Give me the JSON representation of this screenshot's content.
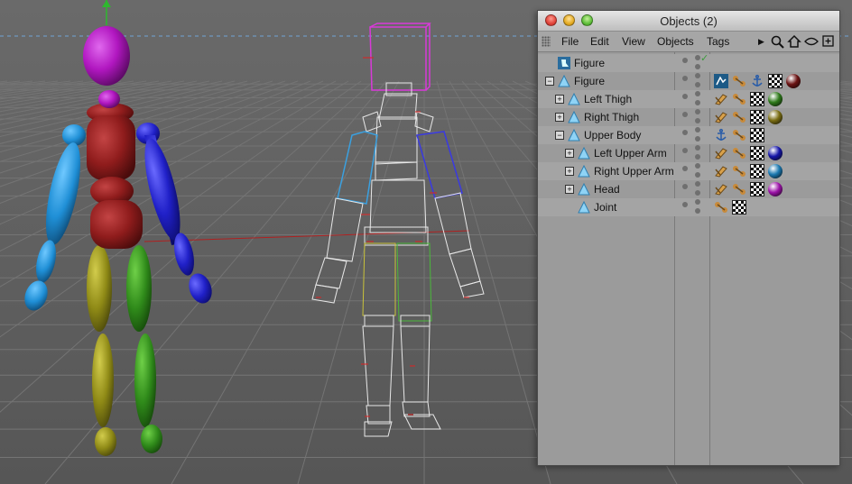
{
  "window": {
    "title": "Objects (2)"
  },
  "menu": {
    "items": [
      "File",
      "Edit",
      "View",
      "Objects",
      "Tags"
    ]
  },
  "toolbar_icons": [
    "arrow-right-icon",
    "search-icon",
    "home-icon",
    "eye-icon",
    "new-window-icon"
  ],
  "objects": [
    {
      "label": "Figure",
      "type": "figure-object",
      "depth": 0,
      "expander": "",
      "tags": [
        "check-tag"
      ]
    },
    {
      "label": "Figure",
      "type": "joint",
      "depth": 0,
      "expander": "−",
      "tags": [
        "display-tag",
        "ik-tag",
        "anchor-tag",
        "texture-tag",
        "material-ball"
      ],
      "material": "#6b1313"
    },
    {
      "label": "Left Thigh",
      "type": "joint",
      "depth": 1,
      "expander": "+",
      "tags": [
        "bone-tag",
        "ik-tag",
        "texture-tag",
        "material-ball"
      ],
      "material": "#2e7a1a"
    },
    {
      "label": "Right Thigh",
      "type": "joint",
      "depth": 1,
      "expander": "+",
      "tags": [
        "bone-tag",
        "ik-tag",
        "texture-tag",
        "material-ball"
      ],
      "material": "#7a6d12"
    },
    {
      "label": "Upper Body",
      "type": "joint",
      "depth": 1,
      "expander": "−",
      "tags": [
        "anchor-tag",
        "ik-tag",
        "texture-tag"
      ]
    },
    {
      "label": "Left Upper Arm",
      "type": "joint",
      "depth": 2,
      "expander": "+",
      "tags": [
        "bone-tag",
        "ik-tag",
        "texture-tag",
        "material-ball"
      ],
      "material": "#1515a8"
    },
    {
      "label": "Right Upper Arm",
      "type": "joint",
      "depth": 2,
      "expander": "+",
      "tags": [
        "bone-tag",
        "ik-tag",
        "texture-tag",
        "material-ball"
      ],
      "material": "#1a78b0"
    },
    {
      "label": "Head",
      "type": "joint",
      "depth": 2,
      "expander": "+",
      "tags": [
        "bone-tag",
        "ik-tag",
        "texture-tag",
        "material-ball"
      ],
      "material": "#9c12a8"
    },
    {
      "label": "Joint",
      "type": "joint",
      "depth": 2,
      "expander": "",
      "tags": [
        "ik-tag",
        "texture-tag"
      ]
    }
  ],
  "colors": {
    "head": "#b117c0",
    "torso": "#8f1c1c",
    "left_arm": "#1f8fd6",
    "right_arm": "#2020c8",
    "left_leg": "#8f8a16",
    "right_leg": "#2f8a1a",
    "viewport_bg": "#5f5f5f"
  }
}
